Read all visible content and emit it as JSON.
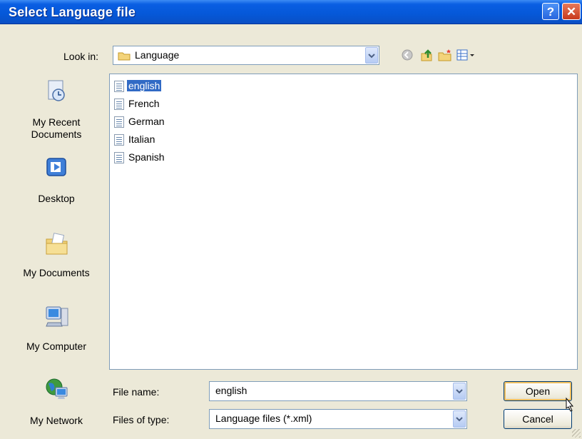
{
  "window": {
    "title": "Select Language file",
    "help_glyph": "?",
    "close_glyph": "✕"
  },
  "toolbar": {
    "look_in_label": "Look in:",
    "look_in_value": "Language",
    "icons": [
      "back-icon",
      "up-folder-icon",
      "new-folder-icon",
      "view-menu-icon"
    ]
  },
  "places": [
    {
      "label": "My Recent Documents",
      "icon": "recent-documents-icon"
    },
    {
      "label": "Desktop",
      "icon": "desktop-icon"
    },
    {
      "label": "My Documents",
      "icon": "my-documents-icon"
    },
    {
      "label": "My Computer",
      "icon": "my-computer-icon"
    },
    {
      "label": "My Network",
      "icon": "my-network-icon"
    }
  ],
  "files": [
    {
      "name": "english",
      "selected": true
    },
    {
      "name": "French",
      "selected": false
    },
    {
      "name": "German",
      "selected": false
    },
    {
      "name": "Italian",
      "selected": false
    },
    {
      "name": "Spanish",
      "selected": false
    }
  ],
  "form": {
    "file_name_label": "File name:",
    "file_name_value": "english",
    "file_type_label": "Files of type:",
    "file_type_value": "Language files (*.xml)"
  },
  "buttons": {
    "open": "Open",
    "cancel": "Cancel"
  },
  "colors": {
    "titlebar": "#0558d8",
    "selection": "#316ac5",
    "dialog_bg": "#ece9d8"
  }
}
